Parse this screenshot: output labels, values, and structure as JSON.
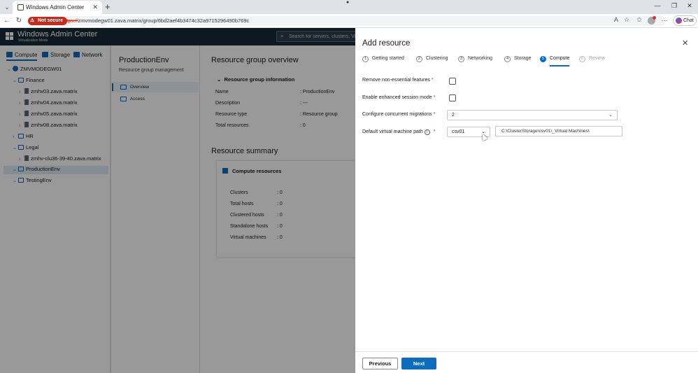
{
  "browser": {
    "tab_title": "Windows Admin Center",
    "not_secure_label": "Not secure",
    "url_scheme": "https://",
    "url_rest": "zmvmodegw01.zava.matrix/group/6bd2aef4b3474c32a9715296490b769c",
    "chat_label": "Chat"
  },
  "app": {
    "title": "Windows Admin Center",
    "subtitle": "Virtualization Mode",
    "search_placeholder": "Search for servers, clusters, VMs"
  },
  "sidebar": {
    "tabs": [
      {
        "label": "Compute"
      },
      {
        "label": "Storage"
      },
      {
        "label": "Network"
      }
    ],
    "tree": [
      {
        "label": "ZMVMODEGW01"
      },
      {
        "label": "Finance"
      },
      {
        "label": "zmhv03.zava.matrix"
      },
      {
        "label": "zmhv04.zava.matrix"
      },
      {
        "label": "zmhv05.zava.matrix"
      },
      {
        "label": "zmhv08.zava.matrix"
      },
      {
        "label": "HR"
      },
      {
        "label": "Legal"
      },
      {
        "label": "zmhv-clu36-39-40.zava.matrix"
      },
      {
        "label": "ProductionEnv"
      },
      {
        "label": "TestingEnv"
      }
    ]
  },
  "group": {
    "title": "ProductionEnv",
    "subtitle": "Resource group management",
    "nav": [
      {
        "label": "Overview"
      },
      {
        "label": "Access"
      }
    ]
  },
  "overview": {
    "title": "Resource group overview",
    "info_header": "Resource group information",
    "info": [
      {
        "key": "Name",
        "value": ": ProductionEnv"
      },
      {
        "key": "Description",
        "value": ": ---"
      },
      {
        "key": "Resource type",
        "value": ": Resource group"
      },
      {
        "key": "Total resources",
        "value": ": 0"
      }
    ],
    "summary_title": "Resource summary",
    "compute_header": "Compute resources",
    "compute": [
      {
        "key": "Clusters",
        "value": ": 0"
      },
      {
        "key": "Total hosts",
        "value": ": 0"
      },
      {
        "key": "Clustered hosts",
        "value": ": 0"
      },
      {
        "key": "Standalone hosts",
        "value": ": 0"
      },
      {
        "key": "Virtual machines",
        "value": ": 0"
      }
    ]
  },
  "panel": {
    "title": "Add resource",
    "steps": [
      {
        "num": "1",
        "label": "Getting started"
      },
      {
        "num": "2",
        "label": "Clustering"
      },
      {
        "num": "3",
        "label": "Networking"
      },
      {
        "num": "4",
        "label": "Storage"
      },
      {
        "num": "5",
        "label": "Compute"
      },
      {
        "num": "6",
        "label": "Review"
      }
    ],
    "fields": {
      "remove_features_label": "Remove non-essential features",
      "session_mode_label": "Enable enhanced session mode",
      "migrations_label": "Configure concurrent migrations",
      "migrations_value": "2",
      "vm_path_label": "Default virtual machine path",
      "vm_path_volume": "csv01",
      "vm_path_value": "C:\\ClusterStorage\\csv01\\_Virtual Machines\\",
      "required_mark": "*",
      "info_mark": "i"
    },
    "buttons": {
      "previous": "Previous",
      "next": "Next"
    }
  },
  "colors": {
    "accent": "#0f6cbd",
    "header_bg": "#172a36",
    "danger": "#c42b1c"
  }
}
